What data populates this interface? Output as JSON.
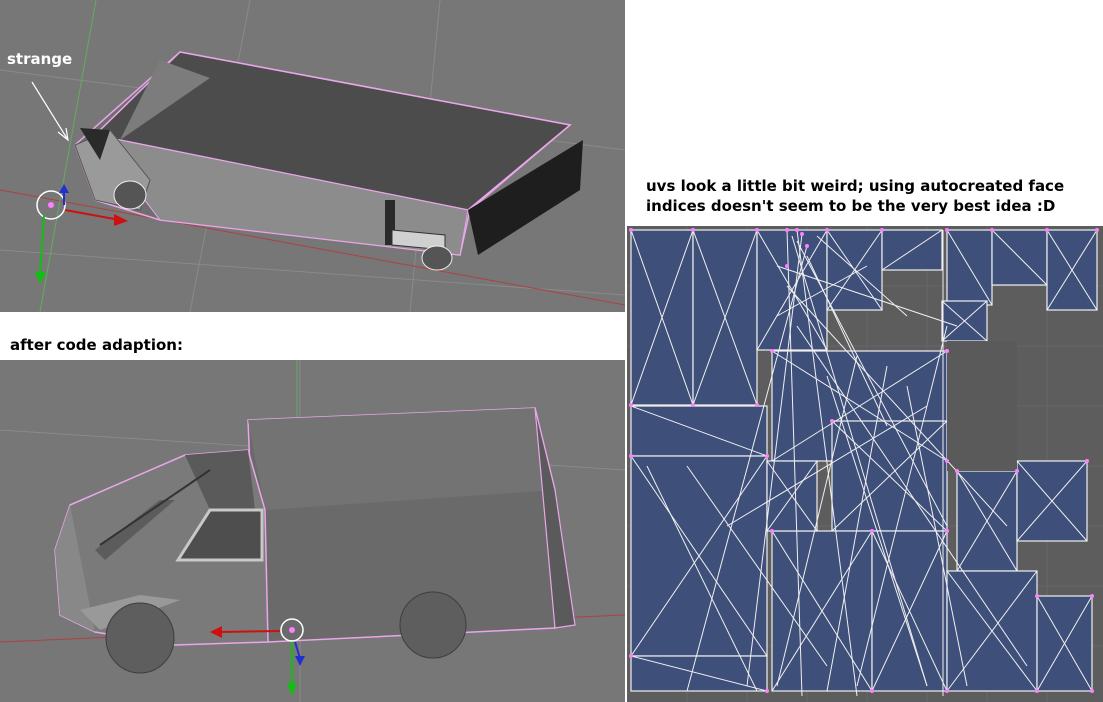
{
  "annotations": {
    "strange_label": "strange",
    "after_label": "after code adaption:",
    "uv_note": "uvs look a little bit weird; using autocreated face\nindices doesn't seem to be the very best idea :D"
  },
  "viewports": [
    {
      "id": "before",
      "background": "#777777",
      "mesh_outline_color": "#e9a6e9"
    },
    {
      "id": "after",
      "background": "#777777",
      "mesh_outline_color": "#e9a6e9"
    }
  ],
  "uv_editor": {
    "background": "#5d5d5d",
    "face_fill": "#3e4f7a",
    "edge_color": "#f0f0f0",
    "vertex_color": "#ff80ff"
  },
  "colors": {
    "axis_x": "#d01010",
    "axis_y": "#10c010",
    "axis_z": "#2030d0"
  }
}
